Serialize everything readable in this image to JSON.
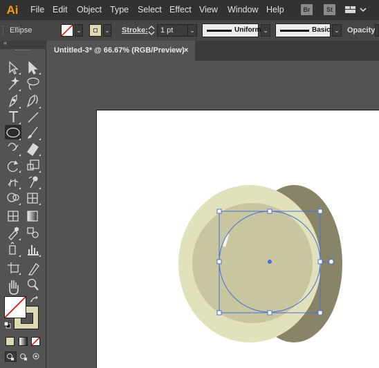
{
  "app": {
    "logo": "Ai",
    "bridge_label": "Br",
    "stock_label": "St"
  },
  "menu": [
    "File",
    "Edit",
    "Object",
    "Type",
    "Select",
    "Effect",
    "View",
    "Window",
    "Help"
  ],
  "control": {
    "selection_label": "Ellipse",
    "stroke_label": "Stroke:",
    "stroke_weight": "1 pt",
    "profile_label": "Uniform",
    "brush_label": "Basic",
    "opacity_label": "Opacity:"
  },
  "document": {
    "tab_title": "Untitled-3* @ 66.67% (RGB/Preview)",
    "close_glyph": "×"
  },
  "colors": {
    "outer_light": "#e1e1bc",
    "shadow": "#878467",
    "inner_fill": "#c7c69f",
    "selection": "#4a6fdc",
    "fill_swatch": "#ddd9b0"
  },
  "icons": [
    "selection-tool-icon",
    "direct-selection-tool-icon",
    "magic-wand-tool-icon",
    "lasso-tool-icon",
    "pen-tool-icon",
    "curvature-tool-icon",
    "type-tool-icon",
    "line-segment-tool-icon",
    "ellipse-tool-icon",
    "paintbrush-tool-icon",
    "shaper-tool-icon",
    "eraser-tool-icon",
    "rotate-tool-icon",
    "scale-tool-icon",
    "width-tool-icon",
    "puppet-warp-tool-icon",
    "shape-builder-tool-icon",
    "perspective-grid-tool-icon",
    "mesh-tool-icon",
    "gradient-tool-icon",
    "eyedropper-tool-icon",
    "blend-tool-icon",
    "symbol-sprayer-tool-icon",
    "column-graph-tool-icon",
    "artboard-tool-icon",
    "slice-tool-icon",
    "hand-tool-icon",
    "zoom-tool-icon"
  ]
}
